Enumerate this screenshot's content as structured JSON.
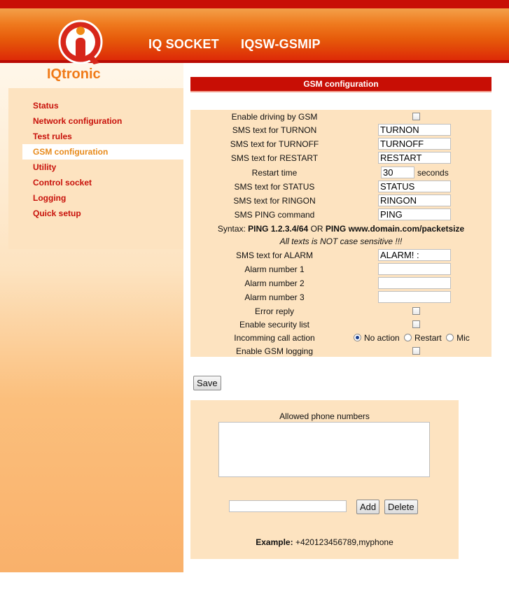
{
  "header": {
    "product": "IQ SOCKET",
    "model": "IQSW-GSMIP",
    "logo_text": "IQtronic"
  },
  "nav": {
    "items": [
      {
        "label": "Status"
      },
      {
        "label": "Network configuration"
      },
      {
        "label": "Test rules"
      },
      {
        "label": "GSM configuration",
        "active": true
      },
      {
        "label": "Utility"
      },
      {
        "label": "Control socket"
      },
      {
        "label": "Logging"
      },
      {
        "label": "Quick setup"
      }
    ]
  },
  "section": {
    "title": "GSM configuration"
  },
  "form": {
    "enable_driving": {
      "label": "Enable driving by GSM",
      "checked": false
    },
    "turnon": {
      "label": "SMS text for TURNON",
      "value": "TURNON"
    },
    "turnoff": {
      "label": "SMS text for TURNOFF",
      "value": "TURNOFF"
    },
    "restart": {
      "label": "SMS text for RESTART",
      "value": "RESTART"
    },
    "restart_time": {
      "label": "Restart time",
      "value": "30",
      "unit": "seconds"
    },
    "status": {
      "label": "SMS text for STATUS",
      "value": "STATUS"
    },
    "ringon": {
      "label": "SMS text for RINGON",
      "value": "RINGON"
    },
    "ping": {
      "label": "SMS PING command",
      "value": "PING"
    },
    "syntax": {
      "prefix": "Syntax: ",
      "ex1": "PING 1.2.3.4/64",
      "or": " OR ",
      "ex2": "PING www.domain.com/packetsize"
    },
    "case_note": "All texts is NOT case sensitive !!!",
    "alarm": {
      "label": "SMS text for ALARM",
      "value": "ALARM! :"
    },
    "alarm1": {
      "label": "Alarm number 1",
      "value": ""
    },
    "alarm2": {
      "label": "Alarm number 2",
      "value": ""
    },
    "alarm3": {
      "label": "Alarm number 3",
      "value": ""
    },
    "error_reply": {
      "label": "Error reply",
      "checked": false
    },
    "security_list": {
      "label": "Enable security list",
      "checked": false
    },
    "incoming_call": {
      "label": "Incomming call action",
      "options": [
        "No action",
        "Restart",
        "Mic"
      ],
      "selected": "No action"
    },
    "gsm_logging": {
      "label": "Enable GSM logging",
      "checked": false
    },
    "save_label": "Save"
  },
  "allowed": {
    "title": "Allowed phone numbers",
    "input_value": "",
    "add_label": "Add",
    "delete_label": "Delete",
    "example_label": "Example:",
    "example_value": " +420123456789,myphone"
  },
  "colors": {
    "accent_red": "#c80e05",
    "nav_active": "#e88a1a",
    "panel": "#fde3c0"
  }
}
